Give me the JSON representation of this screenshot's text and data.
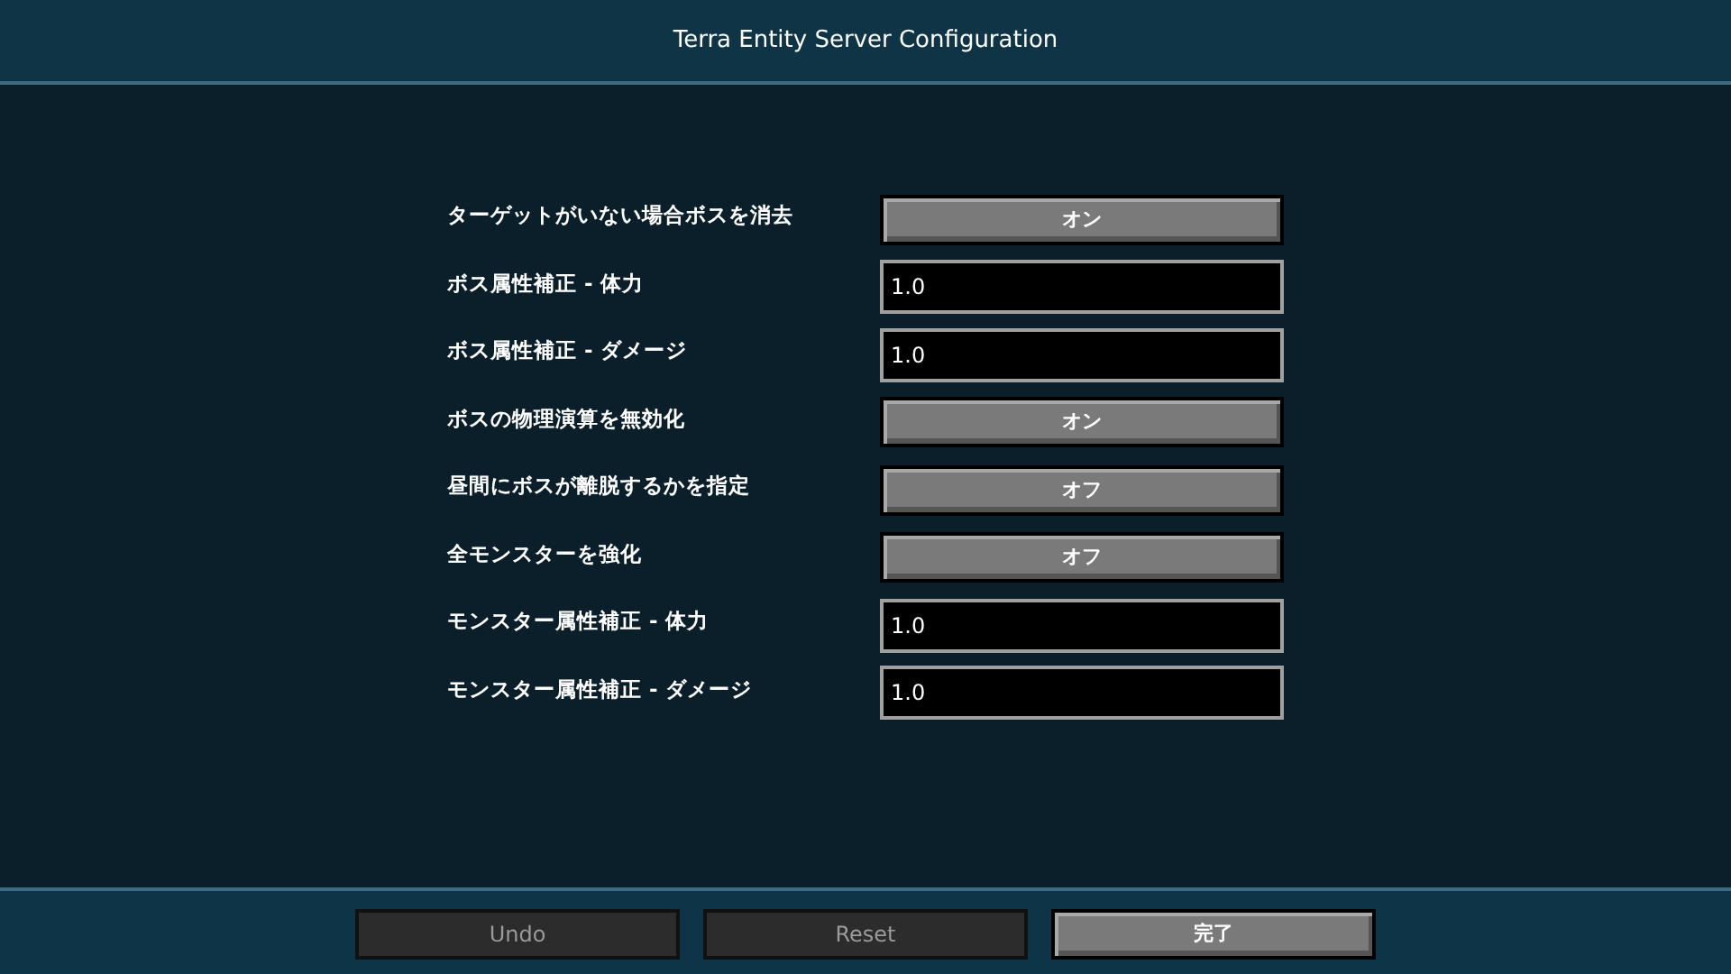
{
  "window": {
    "title": "Terra Entity Server Configuration"
  },
  "options": [
    {
      "label": "ターゲットがいない場合ボスを消去",
      "kind": "toggle",
      "value": "オン"
    },
    {
      "label": "ボス属性補正 - 体力",
      "kind": "number",
      "value": "1.0"
    },
    {
      "label": "ボス属性補正 - ダメージ",
      "kind": "number",
      "value": "1.0"
    },
    {
      "label": "ボスの物理演算を無効化",
      "kind": "toggle",
      "value": "オン"
    },
    {
      "label": "昼間にボスが離脱するかを指定",
      "kind": "toggle",
      "value": "オフ"
    },
    {
      "label": "全モンスターを強化",
      "kind": "toggle",
      "value": "オフ"
    },
    {
      "label": "モンスター属性補正 - 体力",
      "kind": "number",
      "value": "1.0"
    },
    {
      "label": "モンスター属性補正 - ダメージ",
      "kind": "number",
      "value": "1.0"
    }
  ],
  "buttons": [
    {
      "label": "Undo",
      "disabled": true
    },
    {
      "label": "Reset",
      "disabled": true
    },
    {
      "label": "完了",
      "disabled": false
    }
  ]
}
